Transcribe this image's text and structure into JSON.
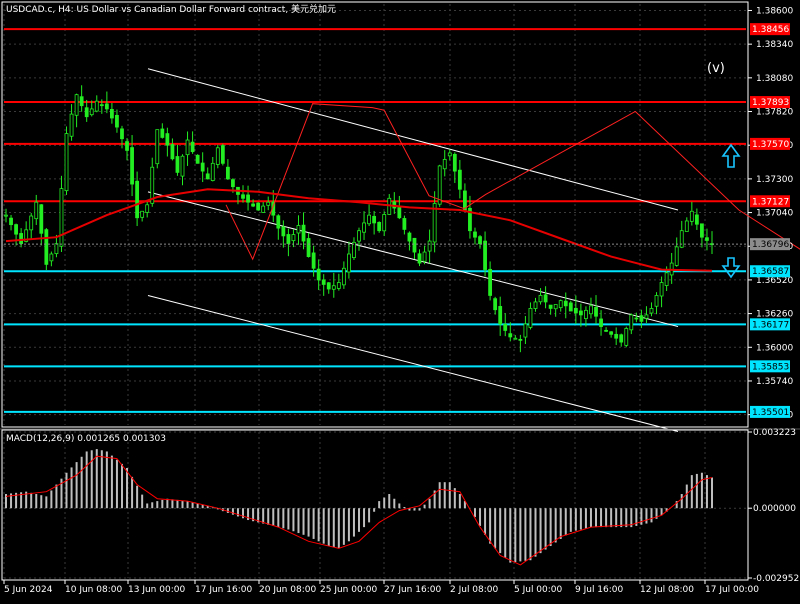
{
  "header": {
    "title": "USDCAD.c, H4:  US Dollar vs Canadian Dollar Forward contract, 美元兑加元"
  },
  "wave_label": "(v)",
  "colors": {
    "background": "#000000",
    "frame": "#ffffff",
    "grid": "#3a3a3a",
    "candle": "#22ee22",
    "zigzag": "#ff2020",
    "moving_average": "#e60000",
    "channel": "#ffffff",
    "resistance": "#ff0000",
    "support": "#00e5ff",
    "current_price": "#8c8c8c",
    "macd_hist": "#bfbfbf",
    "macd_signal": "#ff0000",
    "arrow": "#19c5ff"
  },
  "chart_data": [
    {
      "type": "candlestick",
      "symbol": "USDCAD.c",
      "timeframe": "H4",
      "ylim": [
        1.354,
        1.3865
      ],
      "y_ticks": [
        "1.38600",
        "1.38340",
        "1.38080",
        "1.37820",
        "1.37560",
        "1.37300",
        "1.37040",
        "1.36780",
        "1.36520",
        "1.36260",
        "1.36000",
        "1.35740",
        "1.35480"
      ],
      "x_ticks": [
        "5 Jun 2024",
        "10 Jun 08:00",
        "13 Jun 00:00",
        "17 Jun 16:00",
        "20 Jun 08:00",
        "25 Jun 00:00",
        "27 Jun 16:00",
        "2 Jul 08:00",
        "5 Jul 00:00",
        "9 Jul 16:00",
        "12 Jul 08:00",
        "17 Jul 00:00"
      ],
      "close_path": [
        [
          0,
          1.3702
        ],
        [
          3,
          1.368
        ],
        [
          6,
          1.3712
        ],
        [
          8,
          1.3664
        ],
        [
          10,
          1.368
        ],
        [
          12,
          1.3765
        ],
        [
          14,
          1.3795
        ],
        [
          16,
          1.3778
        ],
        [
          18,
          1.379
        ],
        [
          20,
          1.3784
        ],
        [
          22,
          1.377
        ],
        [
          24,
          1.3752
        ],
        [
          26,
          1.37
        ],
        [
          28,
          1.371
        ],
        [
          30,
          1.3768
        ],
        [
          32,
          1.3756
        ],
        [
          34,
          1.3735
        ],
        [
          36,
          1.376
        ],
        [
          38,
          1.3742
        ],
        [
          40,
          1.373
        ],
        [
          42,
          1.3754
        ],
        [
          44,
          1.373
        ],
        [
          46,
          1.3718
        ],
        [
          48,
          1.3712
        ],
        [
          50,
          1.3706
        ],
        [
          52,
          1.3712
        ],
        [
          54,
          1.3692
        ],
        [
          56,
          1.368
        ],
        [
          58,
          1.3694
        ],
        [
          60,
          1.367
        ],
        [
          62,
          1.3652
        ],
        [
          64,
          1.3645
        ],
        [
          66,
          1.365
        ],
        [
          68,
          1.3672
        ],
        [
          70,
          1.369
        ],
        [
          72,
          1.3702
        ],
        [
          74,
          1.369
        ],
        [
          76,
          1.3715
        ],
        [
          78,
          1.37
        ],
        [
          80,
          1.3682
        ],
        [
          82,
          1.3665
        ],
        [
          84,
          1.3682
        ],
        [
          86,
          1.374
        ],
        [
          88,
          1.375
        ],
        [
          90,
          1.3722
        ],
        [
          92,
          1.369
        ],
        [
          94,
          1.368
        ],
        [
          96,
          1.364
        ],
        [
          98,
          1.3618
        ],
        [
          100,
          1.3608
        ],
        [
          102,
          1.3606
        ],
        [
          104,
          1.363
        ],
        [
          106,
          1.364
        ],
        [
          108,
          1.363
        ],
        [
          110,
          1.3636
        ],
        [
          112,
          1.3628
        ],
        [
          114,
          1.3625
        ],
        [
          116,
          1.3632
        ],
        [
          118,
          1.3616
        ],
        [
          120,
          1.361
        ],
        [
          122,
          1.3604
        ],
        [
          124,
          1.3625
        ],
        [
          126,
          1.362
        ],
        [
          128,
          1.363
        ],
        [
          130,
          1.365
        ],
        [
          132,
          1.3665
        ],
        [
          134,
          1.369
        ],
        [
          136,
          1.3705
        ],
        [
          138,
          1.3685
        ],
        [
          140,
          1.368
        ]
      ],
      "zigzag": [
        [
          1.3695,
          1.371
        ],
        [
          1.372,
          1.3668
        ],
        [
          1.3776,
          1.3788
        ],
        [
          1.3832,
          1.3785
        ],
        [
          1.3843,
          1.3783
        ],
        [
          1.3885,
          1.3717
        ],
        [
          1.3918,
          1.3707
        ],
        [
          1.3938,
          1.3718
        ],
        [
          1.4078,
          1.3782
        ],
        [
          1.4175,
          1.3706
        ],
        [
          1.4334,
          1.3622
        ],
        [
          1.4457,
          1.3723
        ],
        [
          1.4556,
          1.3691
        ],
        [
          1.4637,
          1.3757
        ],
        [
          1.4812,
          1.3654
        ],
        [
          1.5,
          1.3629
        ],
        [
          1.5189,
          1.3634
        ],
        [
          1.5312,
          1.3625
        ],
        [
          1.5623,
          1.3592
        ],
        [
          1.5755,
          1.3637
        ],
        [
          1.5854,
          1.3627
        ],
        [
          1.5932,
          1.367
        ]
      ],
      "moving_average": [
        [
          0,
          1.3682
        ],
        [
          10,
          1.3685
        ],
        [
          20,
          1.3702
        ],
        [
          30,
          1.3716
        ],
        [
          40,
          1.3722
        ],
        [
          50,
          1.372
        ],
        [
          60,
          1.3715
        ],
        [
          70,
          1.3712
        ],
        [
          80,
          1.3708
        ],
        [
          90,
          1.3706
        ],
        [
          100,
          1.3698
        ],
        [
          110,
          1.3684
        ],
        [
          120,
          1.367
        ],
        [
          130,
          1.366
        ],
        [
          140,
          1.3659
        ]
      ],
      "channel": {
        "upper": [
          [
            1.3622,
            1.3815
          ],
          [
            1.4118,
            1.3706
          ]
        ],
        "lower": [
          [
            1.3622,
            1.364
          ],
          [
            1.4118,
            1.3535
          ]
        ],
        "middle": [
          [
            1.3622,
            1.372
          ],
          [
            1.4118,
            1.3616
          ]
        ]
      },
      "levels": [
        {
          "label": "1.38456",
          "value": 1.38456,
          "kind": "resistance"
        },
        {
          "label": "1.37893",
          "value": 1.37893,
          "kind": "resistance"
        },
        {
          "label": "1.37570",
          "value": 1.3757,
          "kind": "resistance"
        },
        {
          "label": "1.37127",
          "value": 1.37127,
          "kind": "resistance"
        },
        {
          "label": "1.36587",
          "value": 1.36587,
          "kind": "support"
        },
        {
          "label": "1.36177",
          "value": 1.36177,
          "kind": "support"
        },
        {
          "label": "1.35853",
          "value": 1.35853,
          "kind": "support"
        },
        {
          "label": "1.35501",
          "value": 1.35501,
          "kind": "support"
        }
      ],
      "current_price": {
        "label": "1.36796",
        "value": 1.36796
      }
    },
    {
      "type": "histogram",
      "title": "MACD(12,26,9) 0.001265 0.001303",
      "ylim": [
        -0.002952,
        0.003223
      ],
      "y_ticks": [
        "0.003223",
        "0.000000",
        "-0.002952"
      ],
      "histogram": [
        [
          0,
          0.0006
        ],
        [
          4,
          0.0007
        ],
        [
          8,
          0.0005
        ],
        [
          12,
          0.0015
        ],
        [
          16,
          0.0024
        ],
        [
          18,
          0.0025
        ],
        [
          20,
          0.0024
        ],
        [
          24,
          0.0017
        ],
        [
          28,
          0.0002
        ],
        [
          32,
          0.0004
        ],
        [
          36,
          0.0003
        ],
        [
          40,
          0.0001
        ],
        [
          44,
          -0.0002
        ],
        [
          48,
          -0.0005
        ],
        [
          52,
          -0.0007
        ],
        [
          56,
          -0.0009
        ],
        [
          60,
          -0.0012
        ],
        [
          64,
          -0.0016
        ],
        [
          66,
          -0.0017
        ],
        [
          68,
          -0.0014
        ],
        [
          72,
          -0.0006
        ],
        [
          74,
          0.0003
        ],
        [
          76,
          0.0006
        ],
        [
          78,
          0.0002
        ],
        [
          80,
          -0.0001
        ],
        [
          82,
          -0.0001
        ],
        [
          84,
          0.0004
        ],
        [
          86,
          0.0011
        ],
        [
          88,
          0.0011
        ],
        [
          90,
          0.0006
        ],
        [
          92,
          0.0
        ],
        [
          96,
          -0.0015
        ],
        [
          100,
          -0.0023
        ],
        [
          104,
          -0.0022
        ],
        [
          108,
          -0.0016
        ],
        [
          112,
          -0.001
        ],
        [
          116,
          -0.0008
        ],
        [
          120,
          -0.0008
        ],
        [
          124,
          -0.0008
        ],
        [
          128,
          -0.0006
        ],
        [
          132,
          0.0
        ],
        [
          134,
          0.0006
        ],
        [
          136,
          0.0014
        ],
        [
          138,
          0.0015
        ],
        [
          140,
          0.0013
        ]
      ],
      "signal": [
        [
          0,
          0.0005
        ],
        [
          8,
          0.0007
        ],
        [
          14,
          0.0014
        ],
        [
          18,
          0.0022
        ],
        [
          22,
          0.0021
        ],
        [
          26,
          0.001
        ],
        [
          30,
          0.0004
        ],
        [
          36,
          0.0003
        ],
        [
          42,
          0.0
        ],
        [
          48,
          -0.0004
        ],
        [
          54,
          -0.0008
        ],
        [
          60,
          -0.0014
        ],
        [
          66,
          -0.0017
        ],
        [
          70,
          -0.0014
        ],
        [
          74,
          -0.0006
        ],
        [
          78,
          -0.0001
        ],
        [
          82,
          0.0001
        ],
        [
          86,
          0.0008
        ],
        [
          90,
          0.0007
        ],
        [
          94,
          -0.0008
        ],
        [
          98,
          -0.002
        ],
        [
          102,
          -0.0024
        ],
        [
          106,
          -0.0018
        ],
        [
          110,
          -0.0012
        ],
        [
          116,
          -0.0008
        ],
        [
          124,
          -0.0007
        ],
        [
          130,
          -0.0003
        ],
        [
          134,
          0.0004
        ],
        [
          138,
          0.0012
        ],
        [
          140,
          0.0013
        ]
      ]
    }
  ]
}
